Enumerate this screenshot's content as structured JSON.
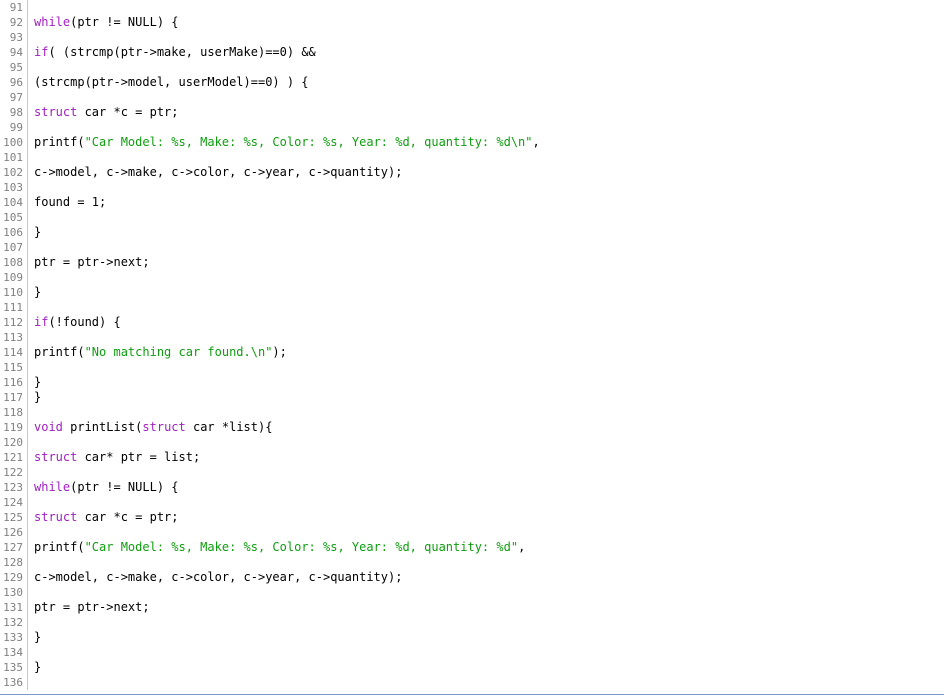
{
  "editor": {
    "language": "C",
    "first_line_number": 91,
    "last_line_number": 136,
    "colors": {
      "background": "#ffffff",
      "text": "#000000",
      "line_number": "#808080",
      "gutter_border": "#c8c8c8",
      "keyword": "#a020c0",
      "string": "#0f9d0f",
      "scrollbar": "#7a9ad0"
    }
  },
  "lines": [
    {
      "number": "91",
      "tokens": []
    },
    {
      "number": "92",
      "tokens": [
        {
          "t": "while",
          "k": "kw"
        },
        {
          "t": "(ptr != NULL) {",
          "k": "txt"
        }
      ]
    },
    {
      "number": "93",
      "tokens": []
    },
    {
      "number": "94",
      "tokens": [
        {
          "t": "if",
          "k": "kw"
        },
        {
          "t": "( (strcmp(ptr->make, userMake)==0) &&",
          "k": "txt"
        }
      ]
    },
    {
      "number": "95",
      "tokens": []
    },
    {
      "number": "96",
      "tokens": [
        {
          "t": "(strcmp(ptr->model, userModel)==0) ) {",
          "k": "txt"
        }
      ]
    },
    {
      "number": "97",
      "tokens": []
    },
    {
      "number": "98",
      "tokens": [
        {
          "t": "struct",
          "k": "kw"
        },
        {
          "t": " car *c = ptr;",
          "k": "txt"
        }
      ]
    },
    {
      "number": "99",
      "tokens": []
    },
    {
      "number": "100",
      "tokens": [
        {
          "t": "printf(",
          "k": "txt"
        },
        {
          "t": "\"Car Model: %s, Make: %s, Color: %s, Year: %d, quantity: %d\\n\"",
          "k": "str"
        },
        {
          "t": ",",
          "k": "txt"
        }
      ]
    },
    {
      "number": "101",
      "tokens": []
    },
    {
      "number": "102",
      "tokens": [
        {
          "t": "c->model, c->make, c->color, c->year, c->quantity);",
          "k": "txt"
        }
      ]
    },
    {
      "number": "103",
      "tokens": []
    },
    {
      "number": "104",
      "tokens": [
        {
          "t": "found = 1;",
          "k": "txt"
        }
      ]
    },
    {
      "number": "105",
      "tokens": []
    },
    {
      "number": "106",
      "tokens": [
        {
          "t": "}",
          "k": "txt"
        }
      ]
    },
    {
      "number": "107",
      "tokens": []
    },
    {
      "number": "108",
      "tokens": [
        {
          "t": "ptr = ptr->next;",
          "k": "txt"
        }
      ]
    },
    {
      "number": "109",
      "tokens": []
    },
    {
      "number": "110",
      "tokens": [
        {
          "t": "}",
          "k": "txt"
        }
      ]
    },
    {
      "number": "111",
      "tokens": []
    },
    {
      "number": "112",
      "tokens": [
        {
          "t": "if",
          "k": "kw"
        },
        {
          "t": "(!found) {",
          "k": "txt"
        }
      ]
    },
    {
      "number": "113",
      "tokens": []
    },
    {
      "number": "114",
      "tokens": [
        {
          "t": "printf(",
          "k": "txt"
        },
        {
          "t": "\"No matching car found.\\n\"",
          "k": "str"
        },
        {
          "t": ");",
          "k": "txt"
        }
      ]
    },
    {
      "number": "115",
      "tokens": []
    },
    {
      "number": "116",
      "tokens": [
        {
          "t": "}",
          "k": "txt"
        }
      ]
    },
    {
      "number": "117",
      "tokens": [
        {
          "t": "}",
          "k": "txt"
        }
      ]
    },
    {
      "number": "118",
      "tokens": []
    },
    {
      "number": "119",
      "tokens": [
        {
          "t": "void",
          "k": "kw"
        },
        {
          "t": " printList(",
          "k": "txt"
        },
        {
          "t": "struct",
          "k": "kw"
        },
        {
          "t": " car *list){",
          "k": "txt"
        }
      ]
    },
    {
      "number": "120",
      "tokens": []
    },
    {
      "number": "121",
      "tokens": [
        {
          "t": "struct",
          "k": "kw"
        },
        {
          "t": " car* ptr = list;",
          "k": "txt"
        }
      ]
    },
    {
      "number": "122",
      "tokens": []
    },
    {
      "number": "123",
      "tokens": [
        {
          "t": "while",
          "k": "kw"
        },
        {
          "t": "(ptr != NULL) {",
          "k": "txt"
        }
      ]
    },
    {
      "number": "124",
      "tokens": []
    },
    {
      "number": "125",
      "tokens": [
        {
          "t": "struct",
          "k": "kw"
        },
        {
          "t": " car *c = ptr;",
          "k": "txt"
        }
      ]
    },
    {
      "number": "126",
      "tokens": []
    },
    {
      "number": "127",
      "tokens": [
        {
          "t": "printf(",
          "k": "txt"
        },
        {
          "t": "\"Car Model: %s, Make: %s, Color: %s, Year: %d, quantity: %d\"",
          "k": "str"
        },
        {
          "t": ",",
          "k": "txt"
        }
      ]
    },
    {
      "number": "128",
      "tokens": []
    },
    {
      "number": "129",
      "tokens": [
        {
          "t": "c->model, c->make, c->color, c->year, c->quantity);",
          "k": "txt"
        }
      ]
    },
    {
      "number": "130",
      "tokens": []
    },
    {
      "number": "131",
      "tokens": [
        {
          "t": "ptr = ptr->next;",
          "k": "txt"
        }
      ]
    },
    {
      "number": "132",
      "tokens": []
    },
    {
      "number": "133",
      "tokens": [
        {
          "t": "}",
          "k": "txt"
        }
      ]
    },
    {
      "number": "134",
      "tokens": []
    },
    {
      "number": "135",
      "tokens": [
        {
          "t": "}",
          "k": "txt"
        }
      ]
    },
    {
      "number": "136",
      "tokens": []
    }
  ]
}
